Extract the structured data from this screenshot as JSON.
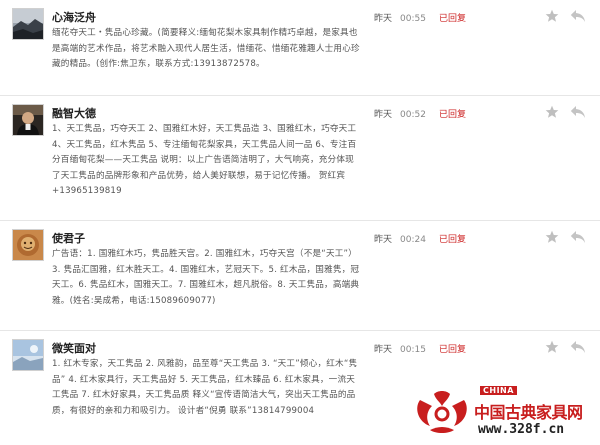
{
  "status_label": "已回复",
  "comments": [
    {
      "name": "心海泛舟",
      "date": "昨天",
      "time": "00:55",
      "text": "缅花夺天工・隽品心珍藏。(简要释义:缅甸花梨木家具制作精巧卓越，是家具也是高端的艺术作品，将艺术融入现代人居生活，惜缅花、惜缅花雅趣人士用心珍藏的精品。(创作:焦卫东，联系方式:13913872578。",
      "avatar_icon": "landscape-avatar-icon"
    },
    {
      "name": "融智大德",
      "date": "昨天",
      "time": "00:52",
      "text": "1、天工隽品，巧夺天工 2、国雅红木好，天工隽品造 3、国雅红木，巧夺天工 4、天工隽品，红木隽品 5、专注缅甸花梨家具，天工隽品人间一品 6、专注百分百缅甸花梨——天工隽品 说明：以上广告语简洁明了，大气响亮，充分体现了天工隽品的品牌形象和产品优势，给人美好联想，易于记忆传播。 贺红宾+13965139819",
      "avatar_icon": "person-avatar-icon"
    },
    {
      "name": "使君子",
      "date": "昨天",
      "time": "00:24",
      "text": "广告语：1. 国雅红木巧，隽品胜天宫。2. 国雅红木，巧夺天宫（不是“天工”）3. 隽品汇国雅，红木胜天工。4. 国雅红木，艺冠天下。5. 红木品，国雅隽，冠天工。6. 隽品红木，国雅天工。7. 国雅红木，超凡脱俗。8. 天工隽品，高端典雅。(姓名:吴成希，电话:15089609077)",
      "avatar_icon": "warm-avatar-icon"
    },
    {
      "name": "微笑面对",
      "date": "昨天",
      "time": "00:15",
      "text": "1. 红木专家，天工隽品 2. 风雅韵，品至尊“天工隽品 3. “天工”倾心，红木“隽品” 4. 红木家具行，天工隽品好 5. 天工隽品，红木臻品 6. 红木家具，一流天工隽品 7. 红木好家具，天工隽品质 释义“宣传语简洁大气，突出天工隽品的品质，有很好的亲和力和吸引力。 设计者“倪勇 联系”13814799004",
      "avatar_icon": "sky-avatar-icon"
    }
  ],
  "logo": {
    "badge": "CHINA",
    "title": "中国古典家具网",
    "url": "www.328f.cn"
  },
  "colors": {
    "replied": "#cc2222",
    "logo_red": "#c81e1e"
  }
}
